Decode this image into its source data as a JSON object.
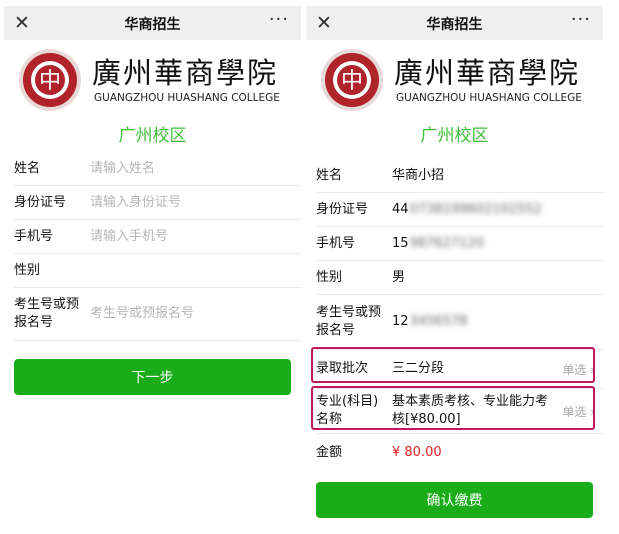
{
  "app": {
    "title": "华商招生",
    "more": "···",
    "close": "✕"
  },
  "brand": {
    "chinese_name": "廣州華商學院",
    "english_name": "GUANGZHOU HUASHANG COLLEGE",
    "emblem_glyph": "中",
    "accent_red": "#b0232a",
    "green": "#3fbf3a"
  },
  "left": {
    "campus": "广州校区",
    "fields": [
      {
        "label": "姓名",
        "placeholder": "请输入姓名"
      },
      {
        "label": "身份证号",
        "placeholder": "请输入身份证号"
      },
      {
        "label": "手机号",
        "placeholder": "请输入手机号"
      },
      {
        "label": "性别",
        "placeholder": ""
      },
      {
        "label": "考生号或预报名号",
        "placeholder": "考生号或预报名号"
      }
    ],
    "next_button": "下一步"
  },
  "right": {
    "campus": "广州校区",
    "name": {
      "label": "姓名",
      "value": "华商小招"
    },
    "id_card": {
      "label": "身份证号",
      "visible": "44",
      "blurred": "0738199602102552"
    },
    "phone": {
      "label": "手机号",
      "visible": "15",
      "blurred": "987627120"
    },
    "gender": {
      "label": "性别",
      "value": "男"
    },
    "exam_no": {
      "label": "考生号或预报名号",
      "visible": "12",
      "blurred": "3456578"
    },
    "batch": {
      "label": "录取批次",
      "value": "三二分段",
      "suffix": "单选 ›"
    },
    "major": {
      "label": "专业(科目)名称",
      "value": "基本素质考核、专业能力考核[¥80.00]",
      "suffix": "单选 ›"
    },
    "amount": {
      "label": "金额",
      "value": "¥ 80.00"
    },
    "confirm_button": "确认缴费"
  }
}
